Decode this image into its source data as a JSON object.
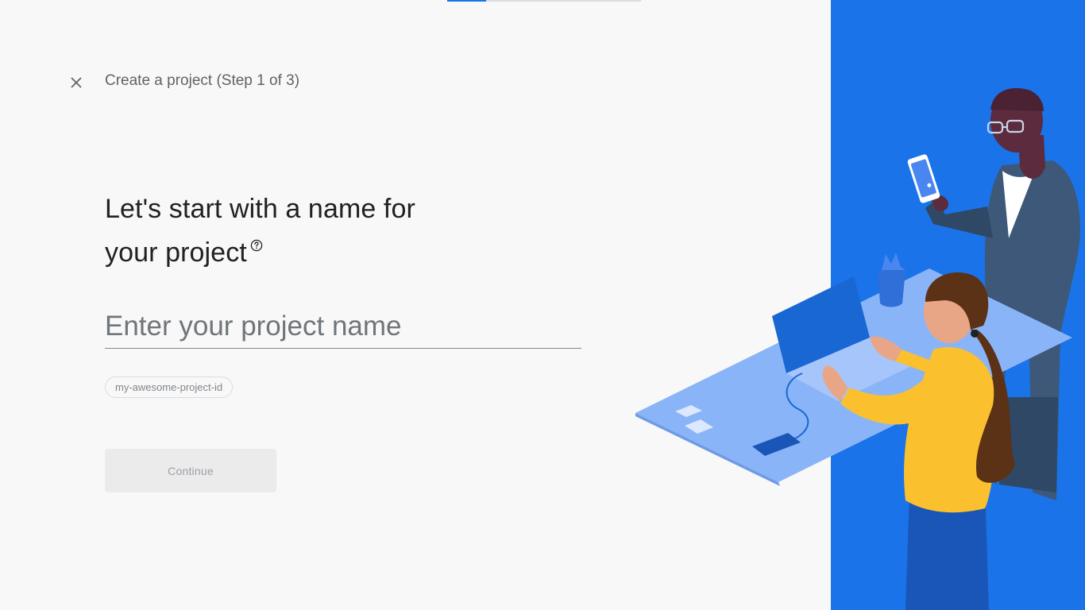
{
  "wizard": {
    "step_title": "Create a project (Step 1 of 3)",
    "progress_fraction": 0.2
  },
  "main": {
    "heading_line1": "Let's start with a name for",
    "heading_line2": "your project",
    "name_input": {
      "placeholder": "Enter your project name",
      "value": ""
    },
    "project_id_chip": "my-awesome-project-id",
    "continue_label": "Continue"
  },
  "icons": {
    "close": "close-icon",
    "help": "help-circle-icon"
  },
  "colors": {
    "accent": "#1a73e8",
    "panel": "#1a73e8",
    "disabled_button": "#ebebeb"
  }
}
